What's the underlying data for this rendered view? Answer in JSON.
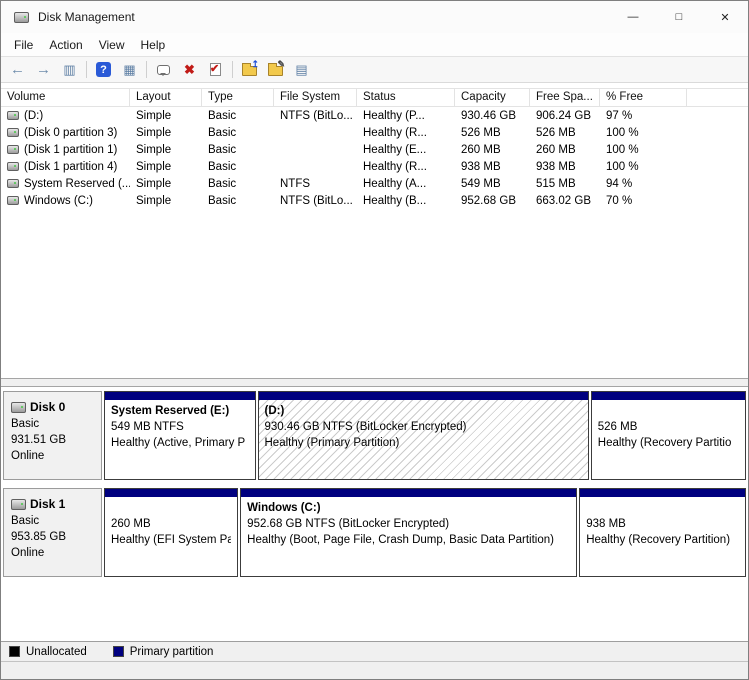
{
  "window": {
    "title": "Disk Management",
    "minimize": "—",
    "maximize": "□",
    "close": "✕"
  },
  "menubar": {
    "items": [
      {
        "label": "File"
      },
      {
        "label": "Action"
      },
      {
        "label": "View"
      },
      {
        "label": "Help"
      }
    ]
  },
  "toolbar": {
    "icons": [
      {
        "name": "back",
        "glyph": "←"
      },
      {
        "name": "forward",
        "glyph": "→"
      },
      {
        "name": "show-console-tree",
        "glyph": "▥"
      },
      {
        "name": "help",
        "glyph": "?"
      },
      {
        "name": "export-list",
        "glyph": "▦"
      },
      {
        "name": "action-pane",
        "glyph": ""
      },
      {
        "name": "delete-volume",
        "glyph": "✖"
      },
      {
        "name": "mark-active",
        "glyph": "✔"
      },
      {
        "name": "change-drive-letter",
        "glyph": "↥"
      },
      {
        "name": "format",
        "glyph": "✎"
      },
      {
        "name": "properties",
        "glyph": "▤"
      }
    ]
  },
  "volume_list": {
    "columns": [
      {
        "label": "Volume"
      },
      {
        "label": "Layout"
      },
      {
        "label": "Type"
      },
      {
        "label": "File System"
      },
      {
        "label": "Status"
      },
      {
        "label": "Capacity"
      },
      {
        "label": "Free Spa..."
      },
      {
        "label": "% Free"
      }
    ],
    "rows": [
      {
        "volume": "(D:)",
        "layout": "Simple",
        "type": "Basic",
        "file_system": "NTFS (BitLo...",
        "status": "Healthy (P...",
        "capacity": "930.46 GB",
        "free_space": "906.24 GB",
        "pct_free": "97 %"
      },
      {
        "volume": "(Disk 0 partition 3)",
        "layout": "Simple",
        "type": "Basic",
        "file_system": "",
        "status": "Healthy (R...",
        "capacity": "526 MB",
        "free_space": "526 MB",
        "pct_free": "100 %"
      },
      {
        "volume": "(Disk 1 partition 1)",
        "layout": "Simple",
        "type": "Basic",
        "file_system": "",
        "status": "Healthy (E...",
        "capacity": "260 MB",
        "free_space": "260 MB",
        "pct_free": "100 %"
      },
      {
        "volume": "(Disk 1 partition 4)",
        "layout": "Simple",
        "type": "Basic",
        "file_system": "",
        "status": "Healthy (R...",
        "capacity": "938 MB",
        "free_space": "938 MB",
        "pct_free": "100 %"
      },
      {
        "volume": "System Reserved (...",
        "layout": "Simple",
        "type": "Basic",
        "file_system": "NTFS",
        "status": "Healthy (A...",
        "capacity": "549 MB",
        "free_space": "515 MB",
        "pct_free": "94 %"
      },
      {
        "volume": "Windows (C:)",
        "layout": "Simple",
        "type": "Basic",
        "file_system": "NTFS (BitLo...",
        "status": "Healthy (B...",
        "capacity": "952.68 GB",
        "free_space": "663.02 GB",
        "pct_free": "70 %"
      }
    ]
  },
  "disks": [
    {
      "name": "Disk 0",
      "type": "Basic",
      "size": "931.51 GB",
      "status": "Online",
      "partitions": [
        {
          "title": "System Reserved  (E:)",
          "line2": "549 MB NTFS",
          "line3": "Healthy (Active, Primary P",
          "selected": false
        },
        {
          "title": "(D:)",
          "line2": "930.46 GB NTFS (BitLocker Encrypted)",
          "line3": "Healthy (Primary Partition)",
          "selected": true
        },
        {
          "title": "",
          "line2": "526 MB",
          "line3": "Healthy (Recovery Partitio",
          "selected": false
        }
      ]
    },
    {
      "name": "Disk 1",
      "type": "Basic",
      "size": "953.85 GB",
      "status": "Online",
      "partitions": [
        {
          "title": "",
          "line2": "260 MB",
          "line3": "Healthy (EFI System Pa",
          "selected": false
        },
        {
          "title": "Windows  (C:)",
          "line2": "952.68 GB NTFS (BitLocker Encrypted)",
          "line3": "Healthy (Boot, Page File, Crash Dump, Basic Data Partition)",
          "selected": false
        },
        {
          "title": "",
          "line2": "938 MB",
          "line3": "Healthy (Recovery Partition)",
          "selected": false
        }
      ]
    }
  ],
  "legend": {
    "items": [
      {
        "label": "Unallocated",
        "color": "#000000"
      },
      {
        "label": "Primary partition",
        "color": "#00007f"
      }
    ]
  },
  "colors": {
    "partition_header": "#00007f",
    "help_bg": "#2a5ad7",
    "delete_red": "#c11b17",
    "arrow_blue": "#6e8cab",
    "folder_yellow": "#f2c94c"
  }
}
